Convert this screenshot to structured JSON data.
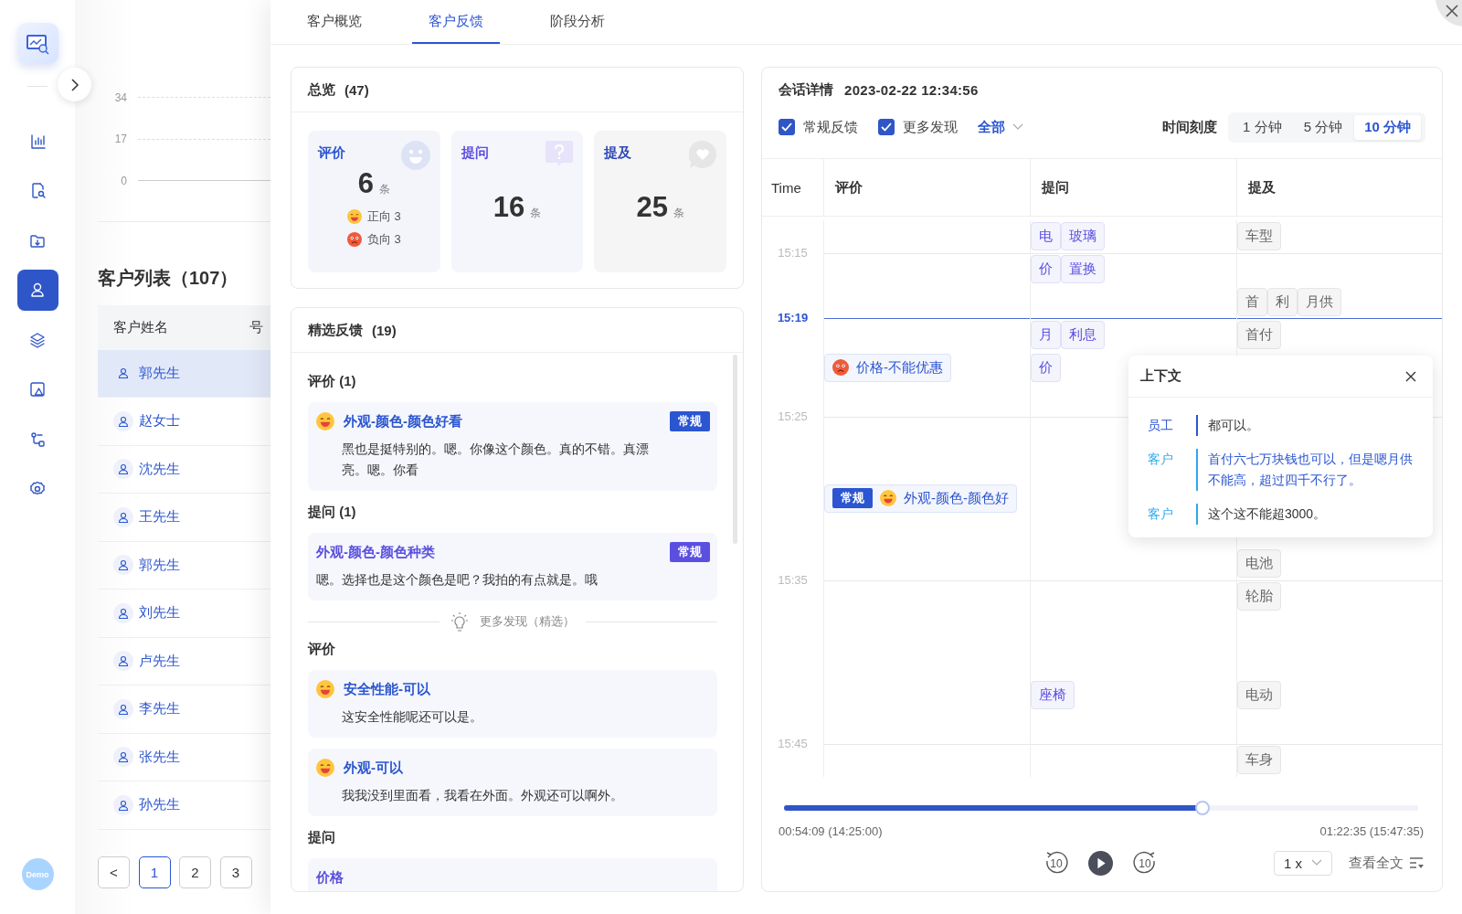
{
  "sidebar": {
    "items": [
      {
        "selected": false
      },
      {
        "selected": false
      },
      {
        "selected": false
      },
      {
        "selected": true
      },
      {
        "selected": false
      },
      {
        "selected": false
      },
      {
        "selected": false
      },
      {
        "selected": false
      }
    ],
    "avatar_label": "Demo"
  },
  "background_page": {
    "axis_labels": [
      "34",
      "17",
      "0"
    ],
    "list_title": "客户列表（107）",
    "columns": [
      "客户姓名",
      "号"
    ],
    "rows": [
      {
        "name": "郭先生",
        "selected": true
      },
      {
        "name": "赵女士",
        "selected": false
      },
      {
        "name": "沈先生",
        "selected": false
      },
      {
        "name": "王先生",
        "selected": false
      },
      {
        "name": "郭先生",
        "selected": false
      },
      {
        "name": "刘先生",
        "selected": false
      },
      {
        "name": "卢先生",
        "selected": false
      },
      {
        "name": "李先生",
        "selected": false
      },
      {
        "name": "张先生",
        "selected": false
      },
      {
        "name": "孙先生",
        "selected": false
      }
    ],
    "prev_label": "<",
    "pages": [
      {
        "label": "1",
        "selected": true
      },
      {
        "label": "2",
        "selected": false
      },
      {
        "label": "3",
        "selected": false
      }
    ]
  },
  "tabs": [
    {
      "label": "客户概览",
      "selected": false
    },
    {
      "label": "客户反馈",
      "selected": true
    },
    {
      "label": "阶段分析",
      "selected": false
    }
  ],
  "overview": {
    "title": "总览",
    "count": "(47)",
    "stats": [
      {
        "kind": "evaluation",
        "label": "评价",
        "count": "6",
        "unit": "条",
        "breakdown": [
          {
            "kind": "positive",
            "label": "正向",
            "count": "3"
          },
          {
            "kind": "negative",
            "label": "负向",
            "count": "3"
          }
        ]
      },
      {
        "kind": "question",
        "label": "提问",
        "count": "16",
        "unit": "条"
      },
      {
        "kind": "mention",
        "label": "提及",
        "count": "25",
        "unit": "条"
      }
    ]
  },
  "featured": {
    "title": "精选反馈",
    "count": "(19)",
    "blocks": [
      {
        "kind": "heading",
        "text": "评价 (1)"
      },
      {
        "kind": "evaluation",
        "emoji": {
          "kind": "happy"
        },
        "title": "外观-颜色-颜色好看",
        "tag": "常规",
        "text": "黑也是挺特别的。嗯。你像这个颜色。真的不错。真漂亮。嗯。你看"
      },
      {
        "kind": "heading",
        "text": "提问 (1)"
      },
      {
        "kind": "question",
        "title": "外观-颜色-颜色种类",
        "tag": "常规",
        "text": "嗯。选择也是这个颜色是吧？我拍的有点就是。哦"
      },
      {
        "kind": "divider",
        "text": "更多发现（精选）"
      },
      {
        "kind": "heading",
        "text": "评价"
      },
      {
        "kind": "evaluation",
        "emoji": {
          "kind": "happy"
        },
        "title": "安全性能-可以",
        "text": "这安全性能呢还可以是。"
      },
      {
        "kind": "evaluation",
        "emoji": {
          "kind": "happy"
        },
        "title": "外观-可以",
        "text": "我我没到里面看，我看在外面。外观还可以啊外。"
      },
      {
        "kind": "heading",
        "text": "提问"
      },
      {
        "kind": "question",
        "title": "价格"
      }
    ]
  },
  "session": {
    "title": "会话详情",
    "timestamp": "2023-02-22 12:34:56",
    "filters": [
      {
        "label": "常规反馈",
        "checked": true
      },
      {
        "label": "更多发现",
        "checked": true
      }
    ],
    "dropdown": "全部",
    "scale_label": "时间刻度",
    "scale_options": [
      {
        "label": "1 分钟",
        "selected": false
      },
      {
        "label": "5 分钟",
        "selected": false
      },
      {
        "label": "10 分钟",
        "selected": true
      }
    ],
    "columns": [
      "Time",
      "评价",
      "提问",
      "提及"
    ],
    "rows": [
      {
        "current": false,
        "question": [
          {
            "text": "电"
          },
          {
            "text": "玻璃"
          }
        ],
        "mention": [
          {
            "text": "车型"
          }
        ]
      },
      {
        "current": false,
        "time": "15:15",
        "question": [
          {
            "text": "价"
          },
          {
            "text": "置换"
          }
        ]
      },
      {
        "current": false,
        "mention": [
          {
            "text": "首"
          },
          {
            "text": "利"
          },
          {
            "text": "月供"
          }
        ]
      },
      {
        "current": true,
        "time": "15:19",
        "question": [
          {
            "text": "月"
          },
          {
            "text": "利息"
          }
        ],
        "mention": [
          {
            "text": "首付"
          }
        ]
      },
      {
        "current": false,
        "evaluation": [
          {
            "emoji": {
              "kind": "upset"
            },
            "text": "价格-不能优惠"
          }
        ],
        "question": [
          {
            "text": "价"
          }
        ]
      },
      {
        "current": false
      },
      {
        "current": false,
        "time": "15:25"
      },
      {
        "current": false
      },
      {
        "current": false,
        "evaluation": [
          {
            "tag": "常规",
            "emoji": {
              "kind": "happy"
            },
            "text": "外观-颜色-颜色好"
          }
        ]
      },
      {
        "current": false
      },
      {
        "current": false,
        "mention": [
          {
            "text": "电池"
          }
        ]
      },
      {
        "current": false,
        "time": "15:35",
        "mention": [
          {
            "text": "轮胎"
          }
        ]
      },
      {
        "current": false
      },
      {
        "current": false
      },
      {
        "current": false,
        "question": [
          {
            "text": "座椅"
          }
        ],
        "mention": [
          {
            "text": "电动"
          }
        ]
      },
      {
        "current": false
      },
      {
        "current": false,
        "time": "15:45",
        "mention": [
          {
            "text": "车身"
          }
        ]
      }
    ],
    "context": {
      "title": "上下文",
      "lines": [
        {
          "kind": "staff",
          "speaker": "员工",
          "text": "都可以。",
          "highlighted": false
        },
        {
          "kind": "customer",
          "speaker": "客户",
          "text": "首付六七万块钱也可以，但是嗯月供不能高，超过四千不行了。",
          "highlighted": true
        },
        {
          "kind": "customer",
          "speaker": "客户",
          "text": "这个这不能超3000。",
          "highlighted": false
        }
      ]
    },
    "player": {
      "level": 0.66,
      "start": "00:54:09 (14:25:00)",
      "end": "01:22:35 (15:47:35)",
      "rewind_label": "10",
      "forward_label": "10",
      "speed": "1 x",
      "transcript_label": "查看全文"
    }
  }
}
